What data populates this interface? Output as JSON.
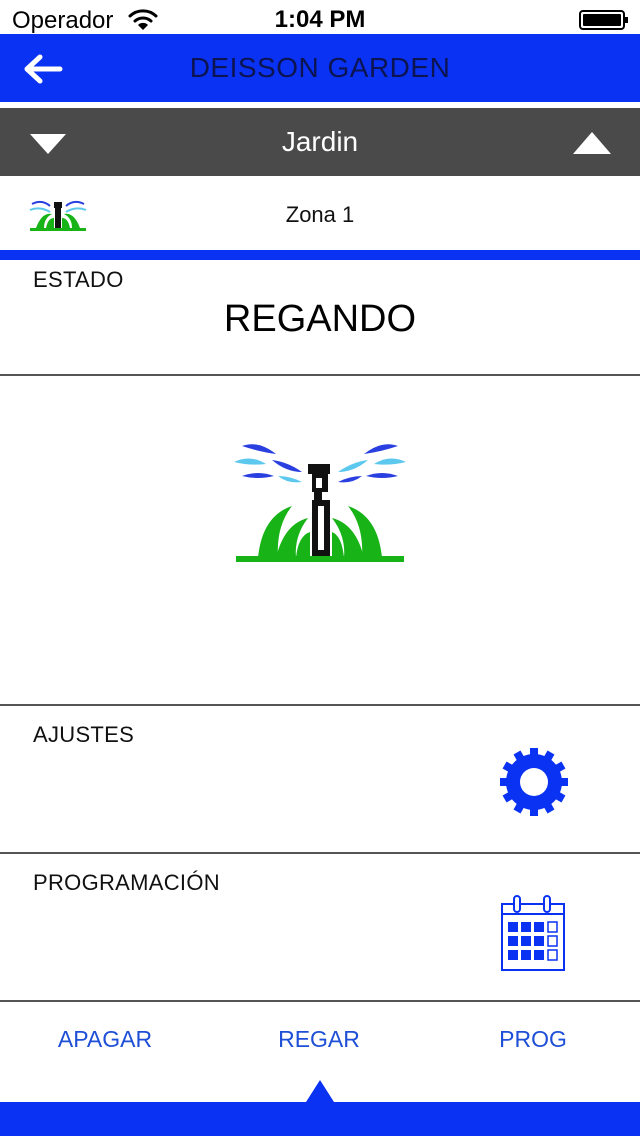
{
  "status": {
    "carrier": "Operador",
    "time": "1:04 PM"
  },
  "nav": {
    "title": "DEISSON GARDEN",
    "back_icon": "arrow-left-icon"
  },
  "garden": {
    "name": "Jardin",
    "prev_icon": "triangle-down-icon",
    "next_icon": "triangle-up-icon"
  },
  "zone": {
    "name": "Zona 1",
    "icon": "sprinkler-icon"
  },
  "estado": {
    "label": "ESTADO",
    "value": "REGANDO"
  },
  "ajustes": {
    "label": "AJUSTES",
    "icon": "gear-icon"
  },
  "programacion": {
    "label": "PROGRAMACIÓN",
    "icon": "calendar-icon"
  },
  "tabs": [
    {
      "label": "APAGAR"
    },
    {
      "label": "REGAR"
    },
    {
      "label": "PROG"
    }
  ],
  "colors": {
    "accent": "#0a32f2",
    "selector_bg": "#4a4a4a",
    "tab_text": "#1e4fd6",
    "grass": "#17b317"
  }
}
